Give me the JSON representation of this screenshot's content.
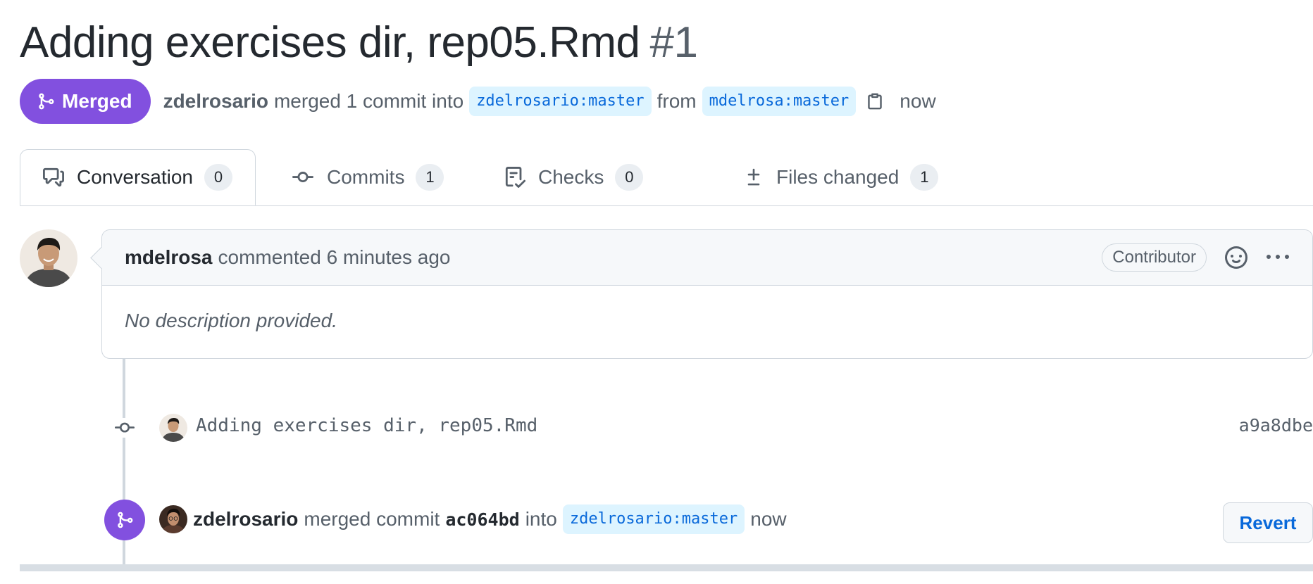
{
  "pr": {
    "title": "Adding exercises dir, rep05.Rmd",
    "number": "#1",
    "status": "Merged",
    "merged_by": "zdelrosario",
    "merged_text": "merged 1 commit into",
    "base_branch": "zdelrosario:master",
    "from_text": "from",
    "head_branch": "mdelrosa:master",
    "time": "now"
  },
  "tabs": [
    {
      "label": "Conversation",
      "count": "0"
    },
    {
      "label": "Commits",
      "count": "1"
    },
    {
      "label": "Checks",
      "count": "0"
    },
    {
      "label": "Files changed",
      "count": "1"
    }
  ],
  "comment": {
    "author": "mdelrosa",
    "action": "commented 6 minutes ago",
    "badge": "Contributor",
    "body": "No description provided."
  },
  "commit": {
    "message": "Adding exercises dir, rep05.Rmd",
    "sha": "a9a8dbe"
  },
  "merge_event": {
    "actor": "zdelrosario",
    "text1": "merged commit",
    "sha": "ac064bd",
    "text2": "into",
    "branch": "zdelrosario:master",
    "time": "now",
    "revert_label": "Revert"
  },
  "colors": {
    "merged_purple": "#8250df",
    "link_blue": "#0969da",
    "branch_bg": "#ddf4ff",
    "border": "#d0d7de"
  },
  "icons": [
    "git-merge-icon",
    "clipboard-icon",
    "comment-discussion-icon",
    "git-commit-icon",
    "checklist-icon",
    "file-diff-icon",
    "smiley-icon",
    "kebab-horizontal-icon"
  ]
}
